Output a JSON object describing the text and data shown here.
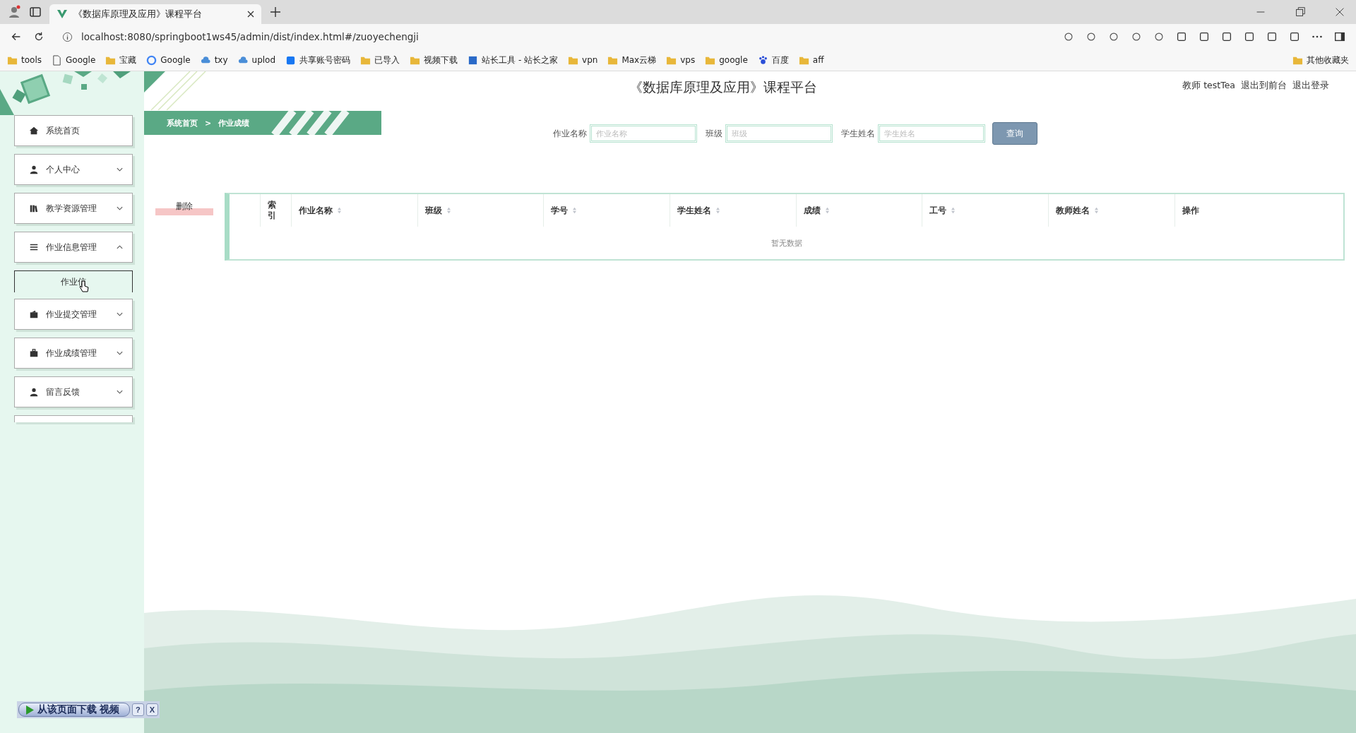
{
  "browser": {
    "tab_title": "《数据库原理及应用》课程平台",
    "url": "localhost:8080/springboot1ws45/admin/dist/index.html#/zuoyechengji",
    "bookmarks": [
      {
        "label": "tools",
        "kind": "folder"
      },
      {
        "label": "Google",
        "kind": "page"
      },
      {
        "label": "宝藏",
        "kind": "folder"
      },
      {
        "label": "Google",
        "kind": "g"
      },
      {
        "label": "txy",
        "kind": "cloud"
      },
      {
        "label": "uplod",
        "kind": "cloud"
      },
      {
        "label": "共享账号密码",
        "kind": "f"
      },
      {
        "label": "已导入",
        "kind": "folder"
      },
      {
        "label": "视频下载",
        "kind": "folder"
      },
      {
        "label": "站长工具 - 站长之家",
        "kind": "site"
      },
      {
        "label": "vpn",
        "kind": "folder"
      },
      {
        "label": "Max云梯",
        "kind": "folder"
      },
      {
        "label": "vps",
        "kind": "folder"
      },
      {
        "label": "google",
        "kind": "folder"
      },
      {
        "label": "百度",
        "kind": "paw"
      },
      {
        "label": "aff",
        "kind": "folder"
      }
    ],
    "other_bookmarks": "其他收藏夹"
  },
  "sidebar": {
    "items": [
      {
        "label": "系统首页",
        "kind": "menu"
      },
      {
        "label": "个人中心",
        "kind": "menu",
        "expanded": false
      },
      {
        "label": "教学资源管理",
        "kind": "menu",
        "expanded": false
      },
      {
        "label": "作业信息管理",
        "kind": "menu",
        "expanded": true
      },
      {
        "label": "作业信",
        "kind": "submenu"
      },
      {
        "label": "作业提交管理",
        "kind": "menu",
        "expanded": false
      },
      {
        "label": "作业成绩管理",
        "kind": "menu",
        "expanded": false
      },
      {
        "label": "留言反馈",
        "kind": "menu",
        "expanded": false
      }
    ]
  },
  "header": {
    "title": "《数据库原理及应用》课程平台",
    "user": "教师 testTea",
    "links": [
      "退出到前台",
      "退出登录"
    ]
  },
  "breadcrumb": [
    "系统首页",
    ">",
    "作业成绩"
  ],
  "search": {
    "fields": [
      {
        "label": "作业名称",
        "placeholder": "作业名称"
      },
      {
        "label": "班级",
        "placeholder": "班级"
      },
      {
        "label": "学生姓名",
        "placeholder": "学生姓名"
      }
    ],
    "button": "查询"
  },
  "delete_button": "删除",
  "table": {
    "columns": [
      {
        "sortable": false
      },
      {
        "label": "索引",
        "sortable": false
      },
      {
        "label": "作业名称",
        "sortable": true
      },
      {
        "label": "班级",
        "sortable": true
      },
      {
        "label": "学号",
        "sortable": true
      },
      {
        "label": "学生姓名",
        "sortable": true
      },
      {
        "label": "成绩",
        "sortable": true
      },
      {
        "label": "工号",
        "sortable": true
      },
      {
        "label": "教师姓名",
        "sortable": true
      },
      {
        "label": "操作",
        "sortable": false
      }
    ],
    "empty_text": "暂无数据"
  },
  "download_bar": {
    "label": "从该页面下载 视频",
    "help": "?",
    "close": "X"
  }
}
